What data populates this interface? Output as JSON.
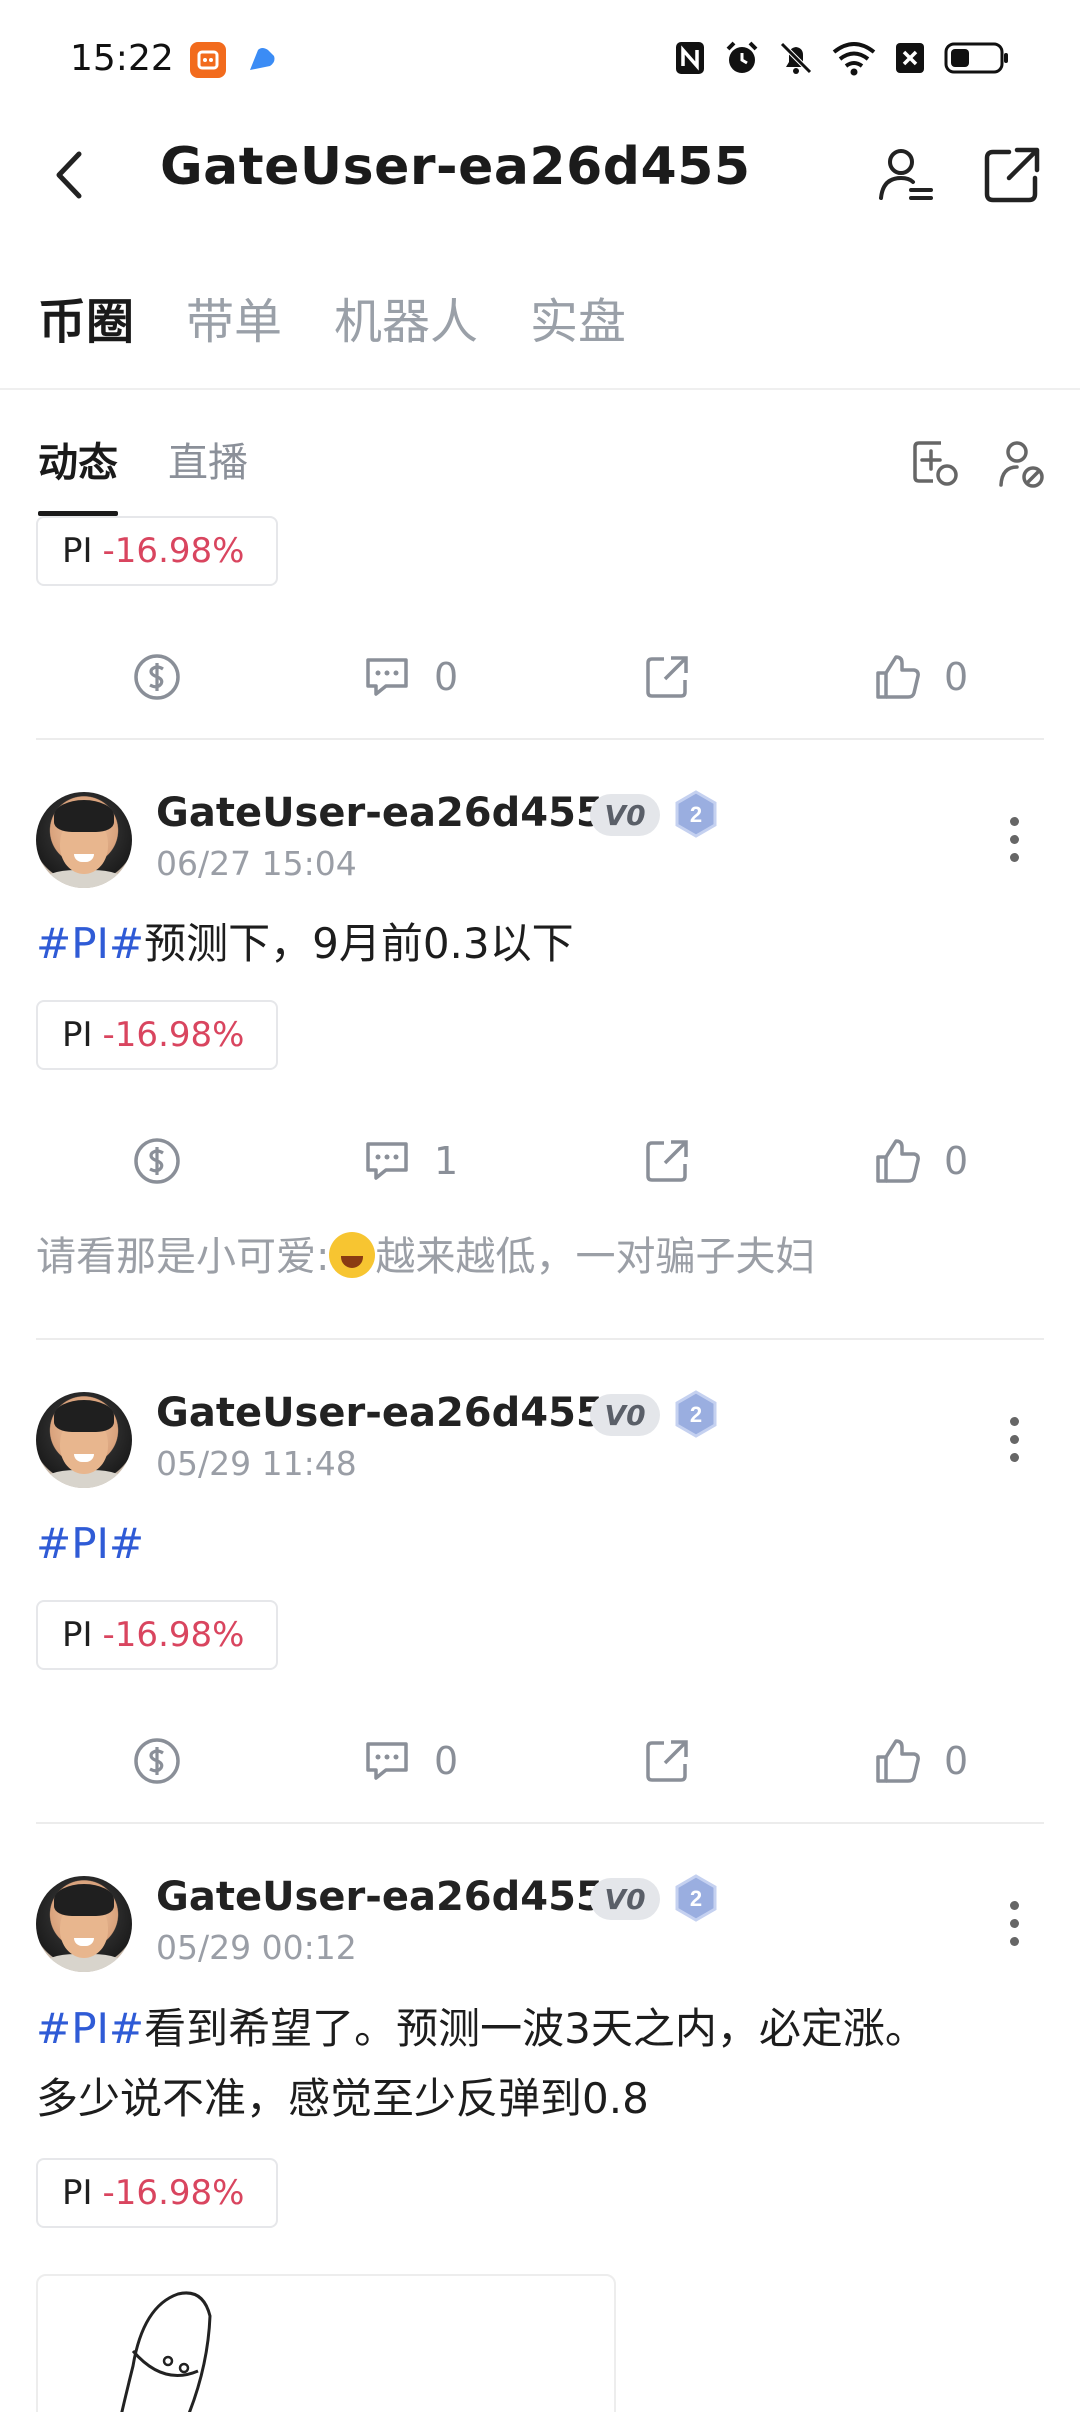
{
  "status_bar": {
    "time": "15:22",
    "icons": [
      "app-orange-icon",
      "app-blue-icon",
      "nfc-icon",
      "alarm-icon",
      "mute-icon",
      "wifi-icon",
      "sim-x-icon",
      "battery-icon"
    ]
  },
  "header": {
    "title": "GateUser-ea26d455"
  },
  "top_tabs": [
    {
      "label": "币圈",
      "active": true
    },
    {
      "label": "带单",
      "active": false
    },
    {
      "label": "机器人",
      "active": false
    },
    {
      "label": "实盘",
      "active": false
    }
  ],
  "sub_tabs": [
    {
      "label": "动态",
      "active": true
    },
    {
      "label": "直播",
      "active": false
    }
  ],
  "colors": {
    "accent_hashtag": "#2f5bd6",
    "negative_change": "#d9455f"
  },
  "partial_post": {
    "coin": {
      "symbol": "PI",
      "change": "-16.98%"
    },
    "comments": "0",
    "likes": "0"
  },
  "posts": [
    {
      "username": "GateUser-ea26d455",
      "vip": "V0",
      "level": "2",
      "time": "06/27 15:04",
      "hashtag": "#PI#",
      "text": "预测下，9月前0.3以下",
      "coin": {
        "symbol": "PI",
        "change": "-16.98%"
      },
      "comments": "1",
      "likes": "0",
      "reply": {
        "author": "请看那是小可爱:",
        "text": "越来越低，一对骗子夫妇"
      }
    },
    {
      "username": "GateUser-ea26d455",
      "vip": "V0",
      "level": "2",
      "time": "05/29 11:48",
      "hashtag": "#PI#",
      "text": "",
      "coin": {
        "symbol": "PI",
        "change": "-16.98%"
      },
      "comments": "0",
      "likes": "0"
    },
    {
      "username": "GateUser-ea26d455",
      "vip": "V0",
      "level": "2",
      "time": "05/29 00:12",
      "hashtag": "#PI#",
      "text": "看到希望了。预测一波3天之内，必定涨。",
      "text_line2": "多少说不准，感觉至少反弹到0.8",
      "coin": {
        "symbol": "PI",
        "change": "-16.98%"
      }
    }
  ]
}
